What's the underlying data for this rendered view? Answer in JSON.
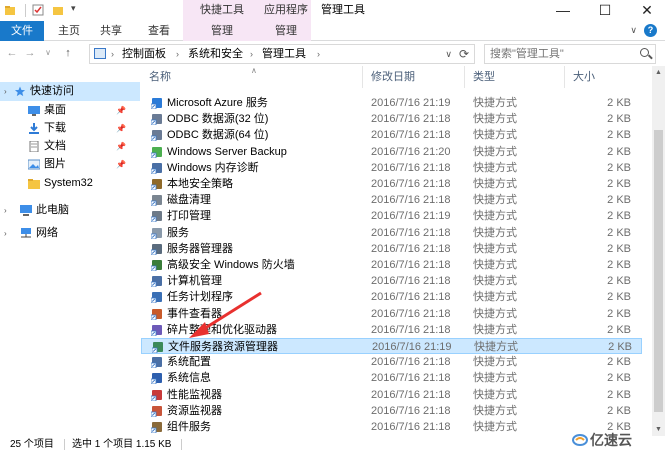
{
  "window": {
    "title": "管理工具",
    "contextual_tabs": [
      "快捷工具",
      "应用程序工具"
    ],
    "controls": {
      "minimize": "—",
      "maximize": "☐",
      "close": "✕"
    }
  },
  "ribbon": {
    "tabs": [
      "文件",
      "主页",
      "共享",
      "查看",
      "管理",
      "管理"
    ],
    "help": "?"
  },
  "address": {
    "breadcrumbs": [
      "控制面板",
      "系统和安全",
      "管理工具"
    ],
    "search_placeholder": "搜索\"管理工具\""
  },
  "nav": {
    "quick_access": "快速访问",
    "items": [
      {
        "label": "桌面",
        "icon": "desktop-icon",
        "pinned": true
      },
      {
        "label": "下载",
        "icon": "download-icon",
        "pinned": true
      },
      {
        "label": "文档",
        "icon": "document-icon",
        "pinned": true
      },
      {
        "label": "图片",
        "icon": "picture-icon",
        "pinned": true
      },
      {
        "label": "System32",
        "icon": "folder-icon",
        "pinned": false
      }
    ],
    "this_pc": "此电脑",
    "network": "网络",
    "pin_glyph": "📌"
  },
  "columns": {
    "name": "名称",
    "date": "修改日期",
    "type": "类型",
    "size": "大小"
  },
  "files": [
    {
      "name": "Microsoft Azure 服务",
      "date": "2016/7/16 21:19",
      "type": "快捷方式",
      "size": "2 KB",
      "icon": "azure-icon"
    },
    {
      "name": "ODBC 数据源(32 位)",
      "date": "2016/7/16 21:18",
      "type": "快捷方式",
      "size": "2 KB",
      "icon": "odbc-icon"
    },
    {
      "name": "ODBC 数据源(64 位)",
      "date": "2016/7/16 21:18",
      "type": "快捷方式",
      "size": "2 KB",
      "icon": "odbc-icon"
    },
    {
      "name": "Windows Server Backup",
      "date": "2016/7/16 21:20",
      "type": "快捷方式",
      "size": "2 KB",
      "icon": "backup-icon"
    },
    {
      "name": "Windows 内存诊断",
      "date": "2016/7/16 21:18",
      "type": "快捷方式",
      "size": "2 KB",
      "icon": "memory-icon"
    },
    {
      "name": "本地安全策略",
      "date": "2016/7/16 21:18",
      "type": "快捷方式",
      "size": "2 KB",
      "icon": "security-policy-icon"
    },
    {
      "name": "磁盘清理",
      "date": "2016/7/16 21:18",
      "type": "快捷方式",
      "size": "2 KB",
      "icon": "disk-cleanup-icon"
    },
    {
      "name": "打印管理",
      "date": "2016/7/16 21:19",
      "type": "快捷方式",
      "size": "2 KB",
      "icon": "print-icon"
    },
    {
      "name": "服务",
      "date": "2016/7/16 21:18",
      "type": "快捷方式",
      "size": "2 KB",
      "icon": "services-icon"
    },
    {
      "name": "服务器管理器",
      "date": "2016/7/16 21:18",
      "type": "快捷方式",
      "size": "2 KB",
      "icon": "server-manager-icon"
    },
    {
      "name": "高级安全 Windows 防火墙",
      "date": "2016/7/16 21:18",
      "type": "快捷方式",
      "size": "2 KB",
      "icon": "firewall-icon"
    },
    {
      "name": "计算机管理",
      "date": "2016/7/16 21:18",
      "type": "快捷方式",
      "size": "2 KB",
      "icon": "computer-management-icon"
    },
    {
      "name": "任务计划程序",
      "date": "2016/7/16 21:18",
      "type": "快捷方式",
      "size": "2 KB",
      "icon": "task-scheduler-icon"
    },
    {
      "name": "事件查看器",
      "date": "2016/7/16 21:18",
      "type": "快捷方式",
      "size": "2 KB",
      "icon": "event-viewer-icon"
    },
    {
      "name": "碎片整理和优化驱动器",
      "date": "2016/7/16 21:18",
      "type": "快捷方式",
      "size": "2 KB",
      "icon": "defrag-icon"
    },
    {
      "name": "文件服务器资源管理器",
      "date": "2016/7/16 21:19",
      "type": "快捷方式",
      "size": "2 KB",
      "icon": "file-server-icon",
      "selected": true
    },
    {
      "name": "系统配置",
      "date": "2016/7/16 21:18",
      "type": "快捷方式",
      "size": "2 KB",
      "icon": "system-config-icon"
    },
    {
      "name": "系统信息",
      "date": "2016/7/16 21:18",
      "type": "快捷方式",
      "size": "2 KB",
      "icon": "system-info-icon"
    },
    {
      "name": "性能监视器",
      "date": "2016/7/16 21:18",
      "type": "快捷方式",
      "size": "2 KB",
      "icon": "performance-icon"
    },
    {
      "name": "资源监视器",
      "date": "2016/7/16 21:18",
      "type": "快捷方式",
      "size": "2 KB",
      "icon": "resource-monitor-icon"
    },
    {
      "name": "组件服务",
      "date": "2016/7/16 21:18",
      "type": "快捷方式",
      "size": "2 KB",
      "icon": "component-services-icon"
    }
  ],
  "status": {
    "count": "25 个项目",
    "selected": "选中 1 个项目  1.15 KB"
  },
  "watermark": {
    "text": "亿速云"
  },
  "colors": {
    "accent": "#1979ca",
    "context_tab": "#f7e6f5",
    "selection": "#cce8ff",
    "arrow": "#e8312f"
  }
}
